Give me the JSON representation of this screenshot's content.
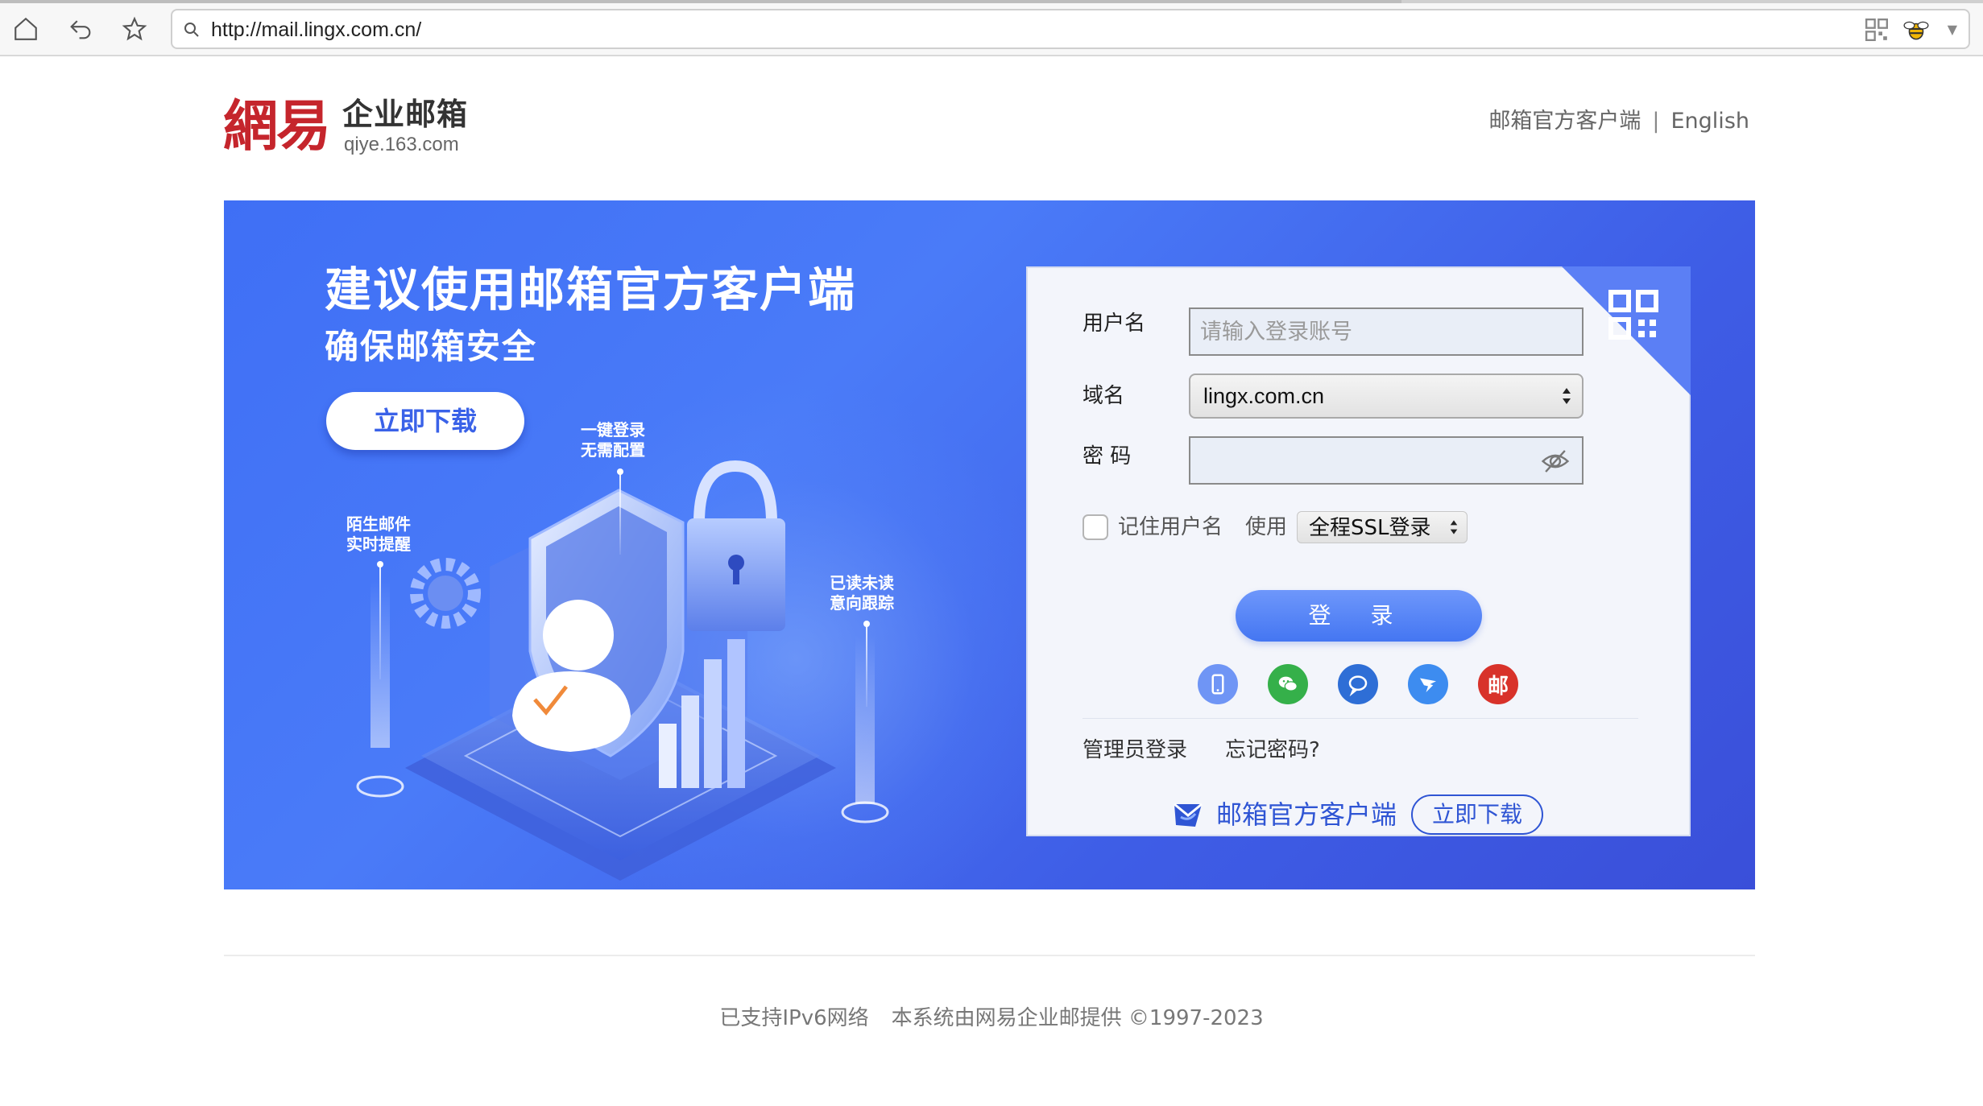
{
  "browser": {
    "url": "http://mail.lingx.com.cn/"
  },
  "header": {
    "logo_main": "網易",
    "logo_name": "企业邮箱",
    "logo_domain": "qiye.163.com",
    "client_link": "邮箱官方客户端",
    "separator": "|",
    "language_link": "English"
  },
  "banner": {
    "title": "建议使用邮箱官方客户端",
    "subtitle": "确保邮箱安全",
    "download_label": "立即下载",
    "features": {
      "login": [
        "一键登录",
        "无需配置"
      ],
      "notify": [
        "陌生邮件",
        "实时提醒"
      ],
      "track": [
        "已读未读",
        "意向跟踪"
      ]
    }
  },
  "login": {
    "username_label": "用户名",
    "username_placeholder": "请输入登录账号",
    "domain_label": "域名",
    "domain_value": "lingx.com.cn",
    "password_label": "密 码",
    "remember_label": "记住用户名",
    "use_label": "使用",
    "ssl_value": "全程SSL登录",
    "login_button": "登 录",
    "social_icons": [
      "phone-icon",
      "wechat-icon",
      "chat-icon",
      "dingtalk-icon",
      "mail-seal-icon"
    ],
    "social_mail_glyph": "邮",
    "admin_login": "管理员登录",
    "forgot_password": "忘记密码?",
    "client_text": "邮箱官方客户端",
    "client_download": "立即下载"
  },
  "footer": {
    "ipv6": "已支持IPv6网络",
    "provider": "本系统由网易企业邮提供 ©1997-2023"
  },
  "colors": {
    "brand_red": "#c5252c",
    "banner_blue": "#4a7bf8",
    "login_button": "#4476f2",
    "link_blue": "#2f55d4"
  }
}
